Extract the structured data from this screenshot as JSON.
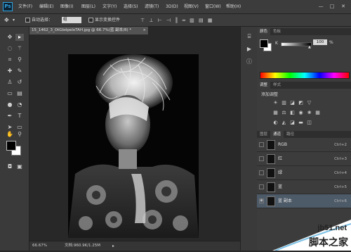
{
  "app": {
    "logo": "Ps"
  },
  "menu": [
    "文件(F)",
    "编辑(E)",
    "图像(I)",
    "图层(L)",
    "文字(Y)",
    "选择(S)",
    "滤镜(T)",
    "3D(D)",
    "视图(V)",
    "窗口(W)",
    "帮助(H)"
  ],
  "window_controls": [
    "—",
    "□",
    "✕"
  ],
  "options": {
    "auto_select_label": "自动选择：",
    "auto_select_value": "组",
    "show_transform_label": "显示变换控件"
  },
  "document": {
    "tab_title": "15_1462_3_OtGbdpeloTAH.jpg @ 66.7%(蓝 副本/8) *",
    "close": "×",
    "zoom": "66.67%",
    "doc_info": "文档:960.9K/1.25M"
  },
  "colors_panel": {
    "tabs": [
      "颜色",
      "色板"
    ],
    "slider_label": "K",
    "slider_value": "100",
    "unit": "%",
    "k_percent": 100
  },
  "adjustments_panel": {
    "tabs": [
      "调整",
      "样式"
    ],
    "title": "添加调整",
    "icons": [
      "brightness-icon",
      "levels-icon",
      "curves-icon",
      "exposure-icon",
      "vibrance-icon",
      "hue-icon",
      "color-balance-icon",
      "bw-icon",
      "photo-filter-icon",
      "channel-mixer-icon",
      "lookup-icon",
      "invert-icon",
      "posterize-icon",
      "threshold-icon",
      "gradient-map-icon",
      "selective-color-icon"
    ]
  },
  "channels_panel": {
    "tabs": [
      "图层",
      "通道",
      "路径"
    ],
    "active_tab": "通道",
    "rows": [
      {
        "name": "RGB",
        "shortcut": "Ctrl+2",
        "active": false
      },
      {
        "name": "红",
        "shortcut": "Ctrl+3",
        "active": false
      },
      {
        "name": "绿",
        "shortcut": "Ctrl+4",
        "active": false
      },
      {
        "name": "蓝",
        "shortcut": "Ctrl+5",
        "active": false
      },
      {
        "name": "蓝 副本",
        "shortcut": "Ctrl+6",
        "active": true
      }
    ]
  },
  "watermark": {
    "site": "jb51.net",
    "brand": "脚本之家"
  }
}
